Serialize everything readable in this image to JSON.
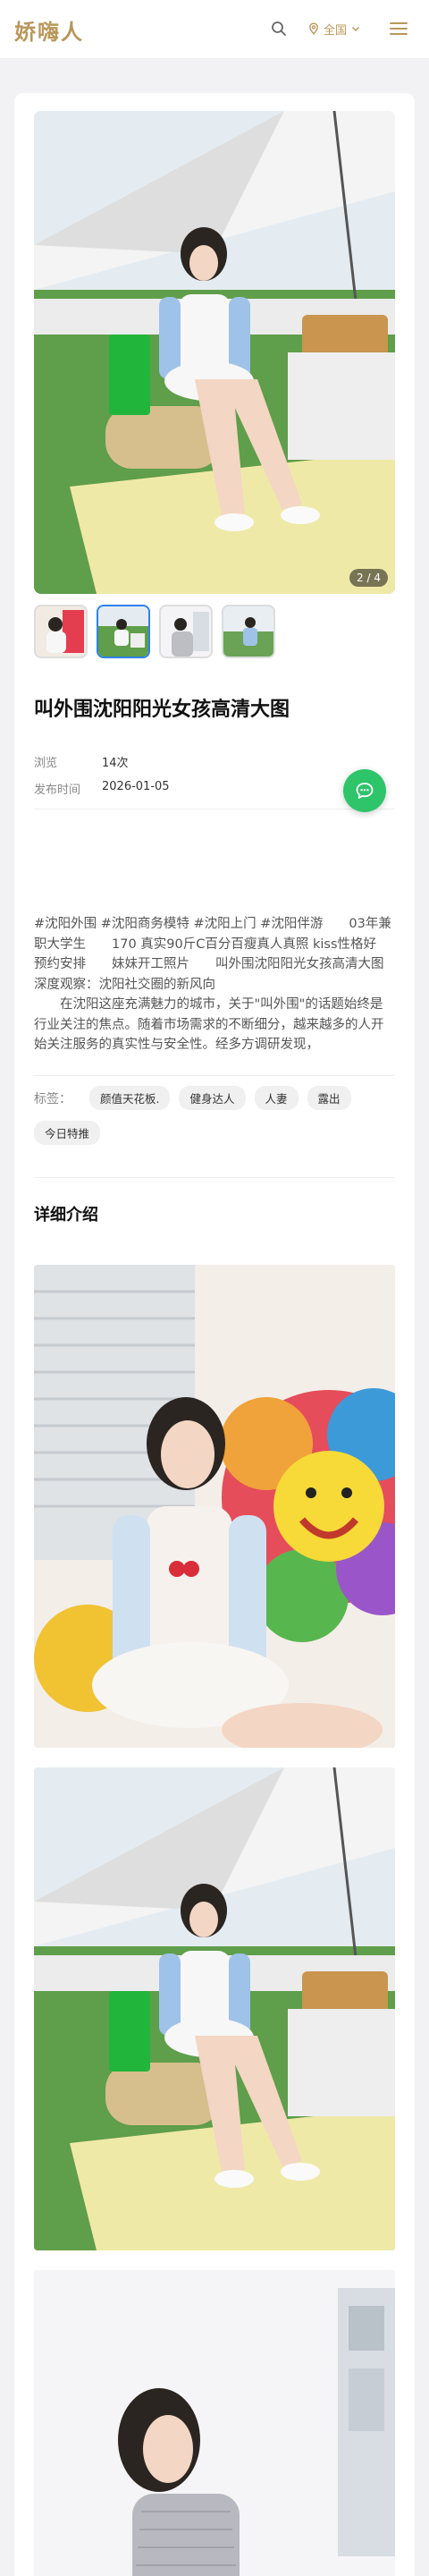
{
  "header": {
    "logo": "娇嗨人",
    "region_label": "全国",
    "search_icon": "search-icon",
    "menu_icon": "hamburger-menu-icon",
    "accent_color": "#b9975b"
  },
  "gallery": {
    "counter": "2 / 4",
    "thumb_count": 4,
    "active_thumb": 2
  },
  "article": {
    "title": "叫外围沈阳阳光女孩高清大图",
    "views_label": "浏览",
    "views_value": "14次",
    "date_label": "发布时间",
    "date_value": "2026-01-05",
    "description": "#沈阳外围 #沈阳商务模特 #沈阳上门 #沈阳伴游　　03年兼职大学生　　170 真实90斤C百分百瘦真人真照 kiss性格好　　预约安排　　妹妹开工照片　　叫外围沈阳阳光女孩高清大图　　深度观察：沈阳社交圈的新风向\n　　在沈阳这座充满魅力的城市，关于\"叫外围\"的话题始终是行业关注的焦点。随着市场需求的不断细分，越来越多的人开始关注服务的真实性与安全性。经多方调研发现，",
    "tags_label": "标签：",
    "tags": [
      "颜值天花板.",
      "健身达人",
      "人妻",
      "露出",
      "今日特推"
    ]
  },
  "detail": {
    "section_title": "详细介绍"
  },
  "fab": {
    "icon": "chat-bubble-icon",
    "color": "#2ec46a"
  }
}
